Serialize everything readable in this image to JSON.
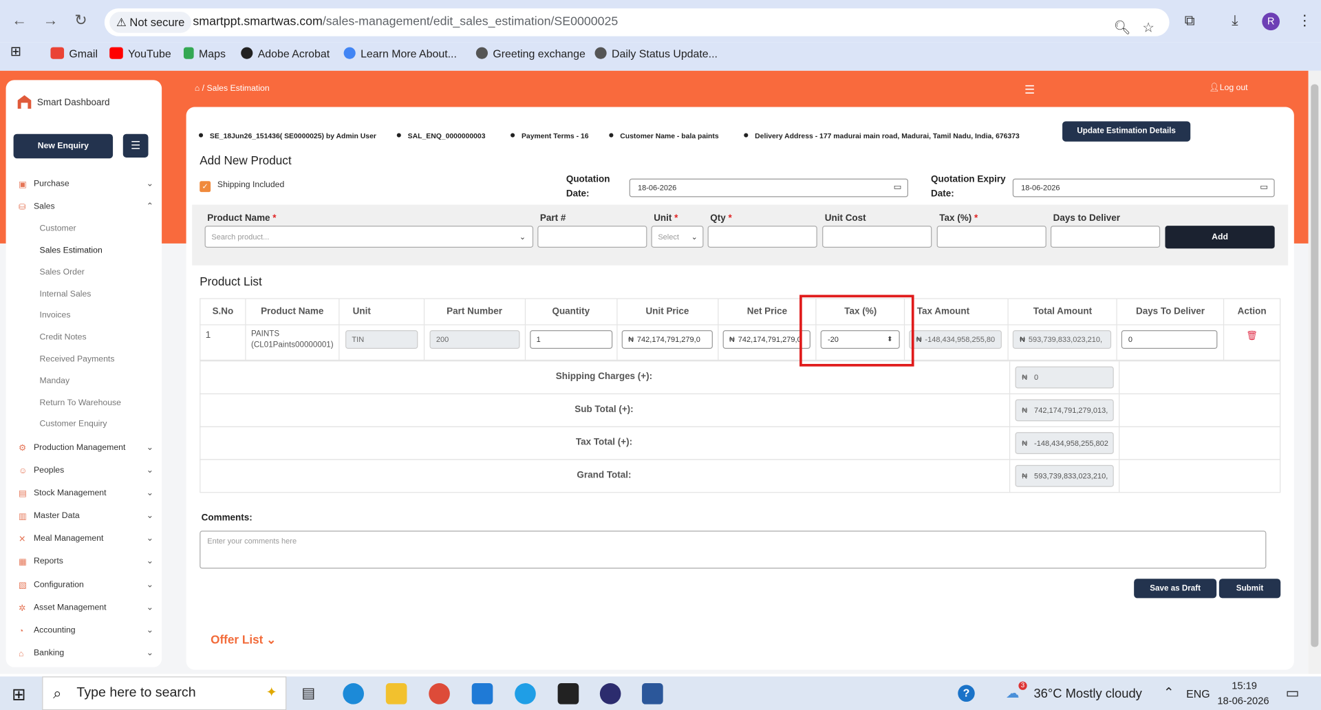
{
  "browser": {
    "not_secure": "Not secure",
    "url_host": "smartppt.smartwas.com",
    "url_path": "/sales-management/edit_sales_estimation/SE0000025",
    "avatar_letter": "R",
    "bookmarks": [
      "Gmail",
      "YouTube",
      "Maps",
      "Adobe Acrobat",
      "Learn More About...",
      "Greeting exchange",
      "Daily Status Update..."
    ]
  },
  "sidebar": {
    "brand": "Smart Dashboard",
    "new_enquiry": "New Enquiry",
    "items": [
      "Purchase",
      "Sales",
      "Production Management",
      "Peoples",
      "Stock Management",
      "Master Data",
      "Meal Management",
      "Reports",
      "Configuration",
      "Asset Management",
      "Accounting",
      "Banking"
    ],
    "sales_sub": [
      "Customer",
      "Sales Estimation",
      "Sales Order",
      "Internal Sales",
      "Invoices",
      "Credit Notes",
      "Received Payments",
      "Manday",
      "Return To Warehouse",
      "Customer Enquiry"
    ]
  },
  "header": {
    "breadcrumb": "Sales Estimation",
    "logout": "Log out"
  },
  "info": {
    "estimation": "SE_18Jun26_151436( SE0000025) by Admin User",
    "enquiry": "SAL_ENQ_0000000003",
    "payment_terms": "Payment Terms - 16",
    "customer": "Customer Name - bala paints",
    "delivery": "Delivery Address - 177 madurai main road, Madurai, Tamil Nadu, India, 676373",
    "update_btn": "Update Estimation Details"
  },
  "form": {
    "title": "Add New Product",
    "shipping_included": "Shipping Included",
    "quotation_date_label": "Quotation Date:",
    "quotation_date": "18-06-2026",
    "expiry_date_label": "Quotation Expiry Date:",
    "expiry_date": "18-06-2026",
    "product_name_label": "Product Name",
    "product_placeholder": "Search product...",
    "part_label": "Part #",
    "unit_label": "Unit",
    "unit_placeholder": "Select",
    "qty_label": "Qty",
    "unit_cost_label": "Unit Cost",
    "tax_label": "Tax (%)",
    "days_label": "Days to Deliver",
    "add_btn": "Add"
  },
  "product_list": {
    "title": "Product List",
    "columns": [
      "S.No",
      "Product Name",
      "Unit",
      "Part Number",
      "Quantity",
      "Unit Price",
      "Net Price",
      "Tax (%)",
      "Tax Amount",
      "Total Amount",
      "Days To Deliver",
      "Action"
    ],
    "row": {
      "sno": "1",
      "product": "PAINTS (CL01Paints00000001)",
      "unit": "TIN",
      "part": "200",
      "qty": "1",
      "unit_price": "742,174,791,279,0",
      "net_price": "742,174,791,279,0",
      "tax": "-20",
      "tax_amount": "-148,434,958,255,80",
      "total": "593,739,833,023,210,",
      "days": "0"
    },
    "currency": "₦"
  },
  "totals": {
    "shipping_label": "Shipping Charges (+):",
    "shipping": "0",
    "subtotal_label": "Sub Total (+):",
    "subtotal": "742,174,791,279,013,",
    "tax_label": "Tax Total (+):",
    "tax": "-148,434,958,255,802",
    "grand_label": "Grand Total:",
    "grand": "593,739,833,023,210,"
  },
  "comments": {
    "label": "Comments:",
    "placeholder": "Enter your comments here",
    "draft_btn": "Save as Draft",
    "submit_btn": "Submit"
  },
  "offer_list": "Offer List",
  "taskbar": {
    "search": "Type here to search",
    "weather": "36°C  Mostly cloudy",
    "lang": "ENG",
    "time": "15:19",
    "date": "18-06-2026",
    "badge": "3"
  }
}
